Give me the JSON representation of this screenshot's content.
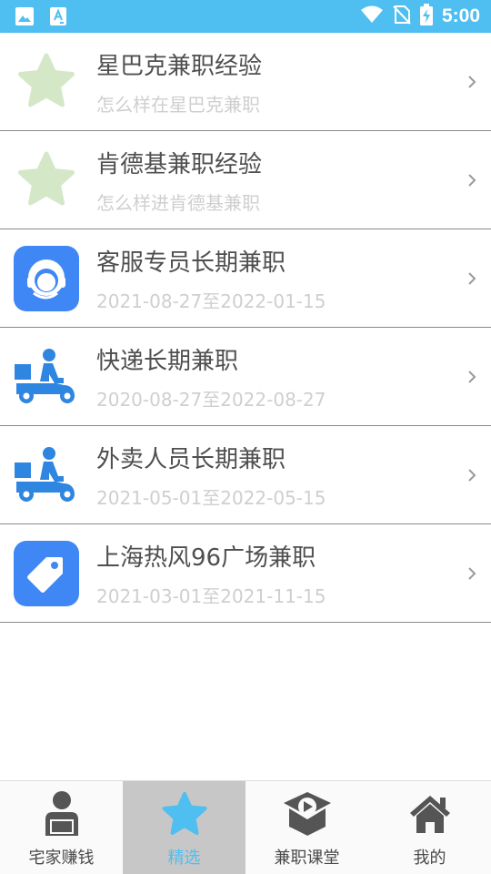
{
  "status_bar": {
    "time": "5:00",
    "icons": [
      "image-icon",
      "text-a-icon",
      "wifi-icon",
      "no-sim-icon",
      "battery-charging-icon"
    ]
  },
  "list": [
    {
      "title": "星巴克兼职经验",
      "subtitle": "怎么样在星巴克兼职",
      "icon": "star-icon"
    },
    {
      "title": "肯德基兼职经验",
      "subtitle": "怎么样进肯德基兼职",
      "icon": "star-icon"
    },
    {
      "title": "客服专员长期兼职",
      "subtitle": "2021-08-27至2022-01-15",
      "icon": "headset-agent-icon"
    },
    {
      "title": "快递长期兼职",
      "subtitle": "2020-08-27至2022-08-27",
      "icon": "delivery-scooter-icon"
    },
    {
      "title": "外卖人员长期兼职",
      "subtitle": "2021-05-01至2022-05-15",
      "icon": "delivery-scooter-icon"
    },
    {
      "title": "上海热风96广场兼职",
      "subtitle": "2021-03-01至2021-11-15",
      "icon": "price-tag-icon"
    }
  ],
  "bottom_nav": {
    "items": [
      {
        "label": "宅家赚钱",
        "icon": "person-laptop-icon"
      },
      {
        "label": "精选",
        "icon": "star-icon",
        "active": true
      },
      {
        "label": "兼职课堂",
        "icon": "video-course-icon"
      },
      {
        "label": "我的",
        "icon": "home-icon"
      }
    ]
  },
  "colors": {
    "status_bar": "#4ebff0",
    "accent": "#4ebff0",
    "star_light": "#d4e8c8",
    "app_tile": "#3f87f4",
    "active_tab_bg": "#c7c7c7"
  }
}
